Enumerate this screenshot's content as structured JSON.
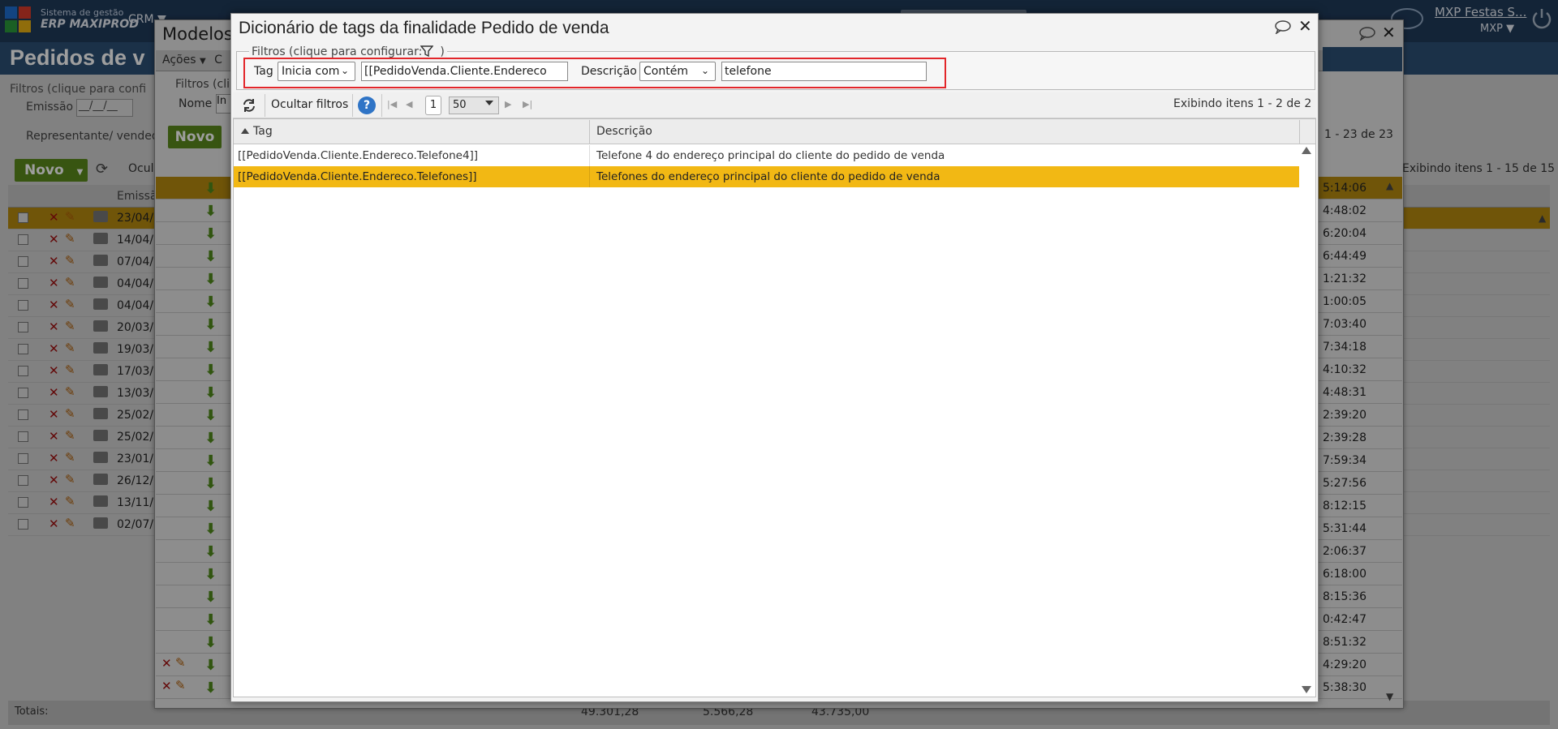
{
  "base": {
    "brand_line1": "Sistema de gestão",
    "brand_line2": "ERP MAXIPROD",
    "menu_crm": "CRM ▼",
    "user_name": "MXP Festas S...",
    "user_sub": "MXP ▼",
    "page_title": "Pedidos de v",
    "filters_legend": "Filtros (clique para confi",
    "emissao_label": "Emissão",
    "emissao_value": "__/__/__",
    "representante_label": "Representante/ vended",
    "novo_label": "Novo",
    "novo_caret": "▼",
    "ocultar_short": "Ocul",
    "col_emissao": "Emissã",
    "dates": [
      "23/04/",
      "14/04/",
      "07/04/",
      "04/04/",
      "04/04/",
      "20/03/",
      "19/03/",
      "17/03/",
      "13/03/",
      "25/02/",
      "25/02/",
      "23/01/",
      "26/12/",
      "13/11/",
      "02/07/"
    ],
    "totais_label": "Totais:",
    "totals": [
      "49.301,28",
      "5.566,28",
      "43.735,00"
    ]
  },
  "modelos": {
    "title": "Modelos",
    "acoes": "Ações",
    "acoes_short": "C",
    "filters_legend": "Filtros (cli",
    "nome_label": "Nome",
    "nome_value": "In",
    "novo_label": "Novo",
    "count_text": "1 - 23 de 23",
    "exibindo_text": "Exibindo itens 1 - 15 de 15",
    "times": [
      "5:14:06",
      "4:48:02",
      "6:20:04",
      "6:44:49",
      "1:21:32",
      "1:00:05",
      "7:03:40",
      "7:34:18",
      "4:10:32",
      "4:48:31",
      "2:39:20",
      "2:39:28",
      "7:59:34",
      "5:27:56",
      "8:12:15",
      "5:31:44",
      "2:06:37",
      "6:18:00",
      "8:15:36",
      "0:42:47",
      "8:51:32",
      "4:29:20",
      "5:38:30"
    ]
  },
  "dialog": {
    "title": "Dicionário de tags da finalidade Pedido de venda",
    "filters_legend": "Filtros (clique para configurar:",
    "filters_legend_end": ")",
    "tag_label": "Tag",
    "tag_operator": "Inicia com",
    "tag_value": "[[PedidoVenda.Cliente.Endereco",
    "desc_label": "Descrição",
    "desc_operator": "Contém",
    "desc_value": "telefone",
    "ocultar_filtros": "Ocultar filtros",
    "help": "?",
    "page_number": "1",
    "page_size": "50",
    "exibindo": "Exibindo itens 1 - 2 de 2",
    "col_tag": "Tag",
    "col_desc": "Descrição",
    "rows": [
      {
        "tag": "[[PedidoVenda.Cliente.Endereco.Telefone4]]",
        "desc": "Telefone 4 do endereço principal do cliente do pedido de venda"
      },
      {
        "tag": "[[PedidoVenda.Cliente.Endereco.Telefones]]",
        "desc": "Telefones do endereço principal do cliente do pedido de venda"
      }
    ]
  },
  "colors": {
    "topbar": "#203a5a",
    "selected_row": "#f2b814",
    "highlight_box": "#e2262a",
    "novo_button": "#5b8a1c",
    "help_icon": "#2f74c6"
  }
}
